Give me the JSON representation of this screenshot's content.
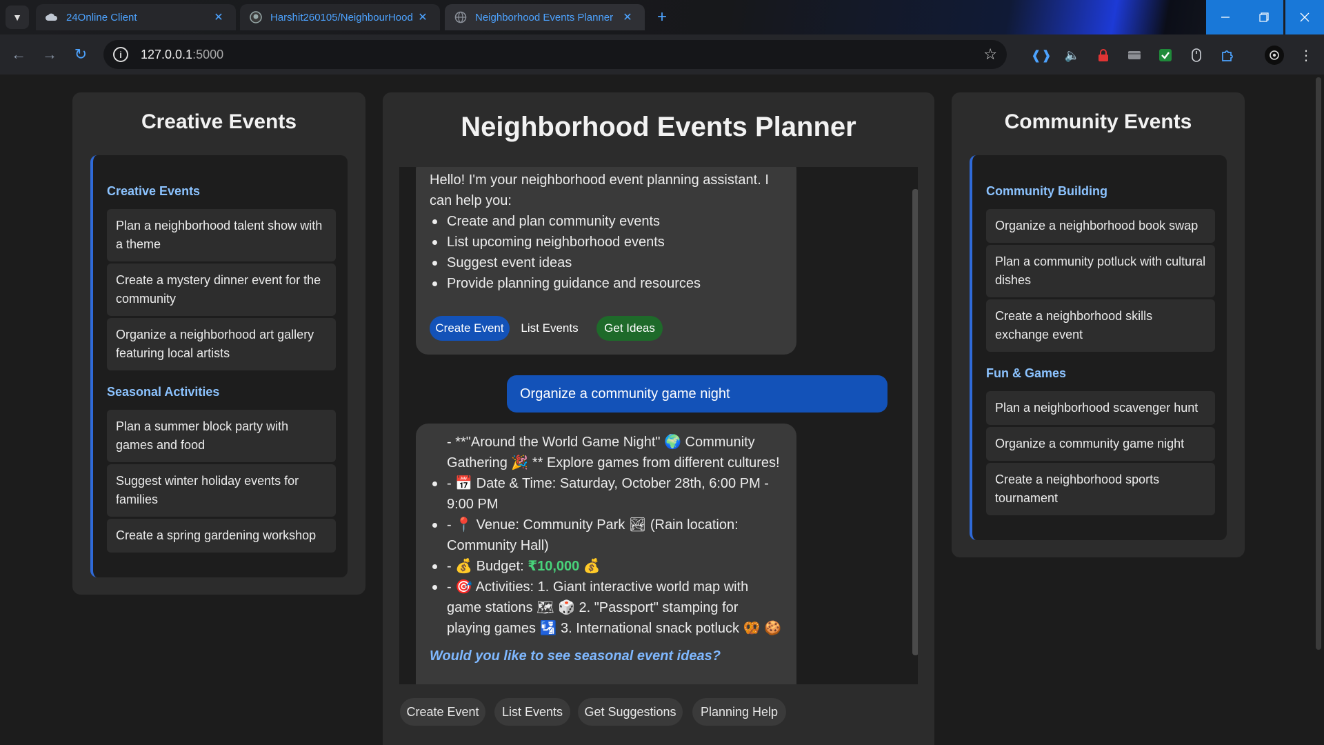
{
  "browser": {
    "tabs": [
      {
        "title": "24Online Client",
        "favicon": "cloud-icon"
      },
      {
        "title": "Harshit260105/NeighbourHood",
        "favicon": "github-icon"
      },
      {
        "title": "Neighborhood Events Planner",
        "favicon": "globe-icon"
      }
    ],
    "url_host": "127.0.0.1",
    "url_port": ":5000"
  },
  "left": {
    "title": "Creative Events",
    "sections": [
      {
        "title": "Creative Events",
        "items": [
          "Plan a neighborhood talent show with a theme",
          "Create a mystery dinner event for the community",
          "Organize a neighborhood art gallery featuring local artists"
        ]
      },
      {
        "title": "Seasonal Activities",
        "items": [
          "Plan a summer block party with games and food",
          "Suggest winter holiday events for families",
          "Create a spring gardening workshop"
        ]
      }
    ]
  },
  "right": {
    "title": "Community Events",
    "sections": [
      {
        "title": "Community Building",
        "items": [
          "Organize a neighborhood book swap",
          "Plan a community potluck with cultural dishes",
          "Create a neighborhood skills exchange event"
        ]
      },
      {
        "title": "Fun & Games",
        "items": [
          "Plan a neighborhood scavenger hunt",
          "Organize a community game night",
          "Create a neighborhood sports tournament"
        ]
      }
    ]
  },
  "center": {
    "title": "Neighborhood Events Planner",
    "welcome": {
      "intro": "Hello! I'm your neighborhood event planning assistant. I can help you:",
      "bullets": [
        "Create and plan community events",
        "List upcoming neighborhood events",
        "Suggest event ideas",
        "Provide planning guidance and resources"
      ],
      "chips": [
        "Create Event",
        "List Events",
        "Get Ideas"
      ]
    },
    "user_message": "Organize a community game night",
    "reply": {
      "header": "- **\"Around the World Game Night\" 🌍 Community Gathering 🎉 ** Explore games from different cultures!",
      "date": "- 📅 Date & Time: Saturday, October 28th, 6:00 PM - 9:00 PM",
      "venue": "- 📍 Venue: Community Park 🏞 (Rain location: Community Hall)",
      "budget_prefix": "- 💰 Budget: ",
      "budget_value": "₹10,000",
      "budget_suffix": " 💰",
      "activities": "- 🎯 Activities: 1. Giant interactive world map with game stations 🗺 🎲 2. \"Passport\" stamping for playing games 🛂 3. International snack potluck 🥨 🍪",
      "followup": "Would you like to see seasonal event ideas?"
    },
    "quick_actions": [
      "Create Event",
      "List Events",
      "Get Suggestions",
      "Planning Help"
    ]
  },
  "colors": {
    "accent_blue": "#1352b8",
    "chip_green": "#1e6a2a",
    "section_title": "#8cc3ff",
    "budget_green": "#48d27a"
  }
}
